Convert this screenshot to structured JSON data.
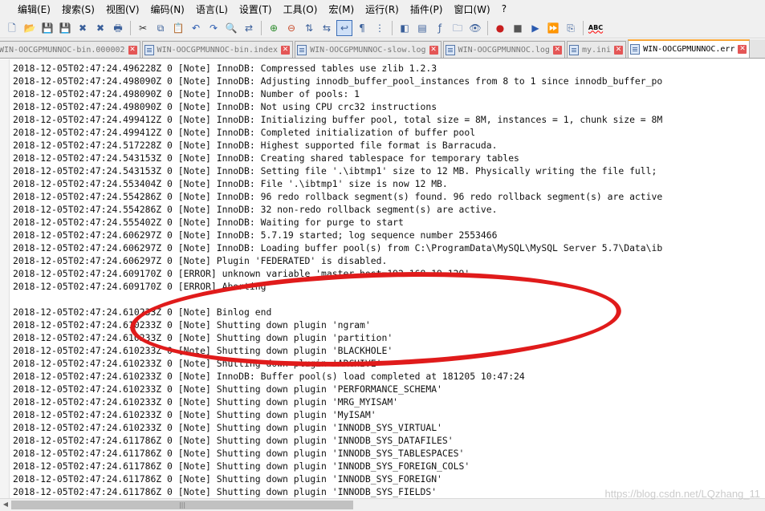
{
  "menu": [
    "编辑(E)",
    "搜索(S)",
    "视图(V)",
    "编码(N)",
    "语言(L)",
    "设置(T)",
    "工具(O)",
    "宏(M)",
    "运行(R)",
    "插件(P)",
    "窗口(W)",
    "?"
  ],
  "toolbar_icons": [
    "new-file",
    "open-file",
    "save",
    "save-all",
    "close",
    "close-all",
    "print",
    "cut",
    "copy",
    "paste",
    "undo",
    "redo",
    "find",
    "replace",
    "zoom-in",
    "zoom-out",
    "sync-v",
    "sync-h",
    "word-wrap",
    "show-all-chars",
    "indent-guide",
    "udl",
    "doc-map",
    "function-list",
    "folder-workspace",
    "monitoring",
    "record-macro",
    "stop-record",
    "play-macro",
    "run-macro-multiple",
    "save-macro",
    "spell-check"
  ],
  "tabs": [
    {
      "label": "WIN-OOCGPMUNNOC-bin.000002",
      "active": false
    },
    {
      "label": "WIN-OOCGPMUNNOC-bin.index",
      "active": false
    },
    {
      "label": "WIN-OOCGPMUNNOC-slow.log",
      "active": false
    },
    {
      "label": "WIN-OOCGPMUNNOC.log",
      "active": false
    },
    {
      "label": "my.ini",
      "active": false
    },
    {
      "label": "WIN-OOCGPMUNNOC.err",
      "active": true
    }
  ],
  "lines": [
    "2018-12-05T02:47:24.496228Z 0 [Note] InnoDB: Compressed tables use zlib 1.2.3",
    "2018-12-05T02:47:24.498090Z 0 [Note] InnoDB: Adjusting innodb_buffer_pool_instances from 8 to 1 since innodb_buffer_po",
    "2018-12-05T02:47:24.498090Z 0 [Note] InnoDB: Number of pools: 1",
    "2018-12-05T02:47:24.498090Z 0 [Note] InnoDB: Not using CPU crc32 instructions",
    "2018-12-05T02:47:24.499412Z 0 [Note] InnoDB: Initializing buffer pool, total size = 8M, instances = 1, chunk size = 8M",
    "2018-12-05T02:47:24.499412Z 0 [Note] InnoDB: Completed initialization of buffer pool",
    "2018-12-05T02:47:24.517228Z 0 [Note] InnoDB: Highest supported file format is Barracuda.",
    "2018-12-05T02:47:24.543153Z 0 [Note] InnoDB: Creating shared tablespace for temporary tables",
    "2018-12-05T02:47:24.543153Z 0 [Note] InnoDB: Setting file '.\\ibtmp1' size to 12 MB. Physically writing the file full;",
    "2018-12-05T02:47:24.553404Z 0 [Note] InnoDB: File '.\\ibtmp1' size is now 12 MB.",
    "2018-12-05T02:47:24.554286Z 0 [Note] InnoDB: 96 redo rollback segment(s) found. 96 redo rollback segment(s) are active",
    "2018-12-05T02:47:24.554286Z 0 [Note] InnoDB: 32 non-redo rollback segment(s) are active.",
    "2018-12-05T02:47:24.555402Z 0 [Note] InnoDB: Waiting for purge to start",
    "2018-12-05T02:47:24.606297Z 0 [Note] InnoDB: 5.7.19 started; log sequence number 2553466",
    "2018-12-05T02:47:24.606297Z 0 [Note] InnoDB: Loading buffer pool(s) from C:\\ProgramData\\MySQL\\MySQL Server 5.7\\Data\\ib",
    "2018-12-05T02:47:24.606297Z 0 [Note] Plugin 'FEDERATED' is disabled.",
    "2018-12-05T02:47:24.609170Z 0 [ERROR] unknown variable 'master-host=192.168.19.129'",
    "2018-12-05T02:47:24.609170Z 0 [ERROR] Aborting",
    "",
    "2018-12-05T02:47:24.610233Z 0 [Note] Binlog end",
    "2018-12-05T02:47:24.610233Z 0 [Note] Shutting down plugin 'ngram'",
    "2018-12-05T02:47:24.610233Z 0 [Note] Shutting down plugin 'partition'",
    "2018-12-05T02:47:24.610233Z 0 [Note] Shutting down plugin 'BLACKHOLE'",
    "2018-12-05T02:47:24.610233Z 0 [Note] Shutting down plugin 'ARCHIVE'",
    "2018-12-05T02:47:24.610233Z 0 [Note] InnoDB: Buffer pool(s) load completed at 181205 10:47:24",
    "2018-12-05T02:47:24.610233Z 0 [Note] Shutting down plugin 'PERFORMANCE_SCHEMA'",
    "2018-12-05T02:47:24.610233Z 0 [Note] Shutting down plugin 'MRG_MYISAM'",
    "2018-12-05T02:47:24.610233Z 0 [Note] Shutting down plugin 'MyISAM'",
    "2018-12-05T02:47:24.610233Z 0 [Note] Shutting down plugin 'INNODB_SYS_VIRTUAL'",
    "2018-12-05T02:47:24.611786Z 0 [Note] Shutting down plugin 'INNODB_SYS_DATAFILES'",
    "2018-12-05T02:47:24.611786Z 0 [Note] Shutting down plugin 'INNODB_SYS_TABLESPACES'",
    "2018-12-05T02:47:24.611786Z 0 [Note] Shutting down plugin 'INNODB_SYS_FOREIGN_COLS'",
    "2018-12-05T02:47:24.611786Z 0 [Note] Shutting down plugin 'INNODB_SYS_FOREIGN'",
    "2018-12-05T02:47:24.611786Z 0 [Note] Shutting down plugin 'INNODB_SYS_FIELDS'"
  ],
  "scrollbar_thumb_grip": "|||",
  "watermark": "https://blog.csdn.net/LQzhang_11",
  "colors": {
    "annotation": "#e01b1b",
    "active_tab_accent": "#f7a434",
    "tab_close": "#e45656"
  }
}
